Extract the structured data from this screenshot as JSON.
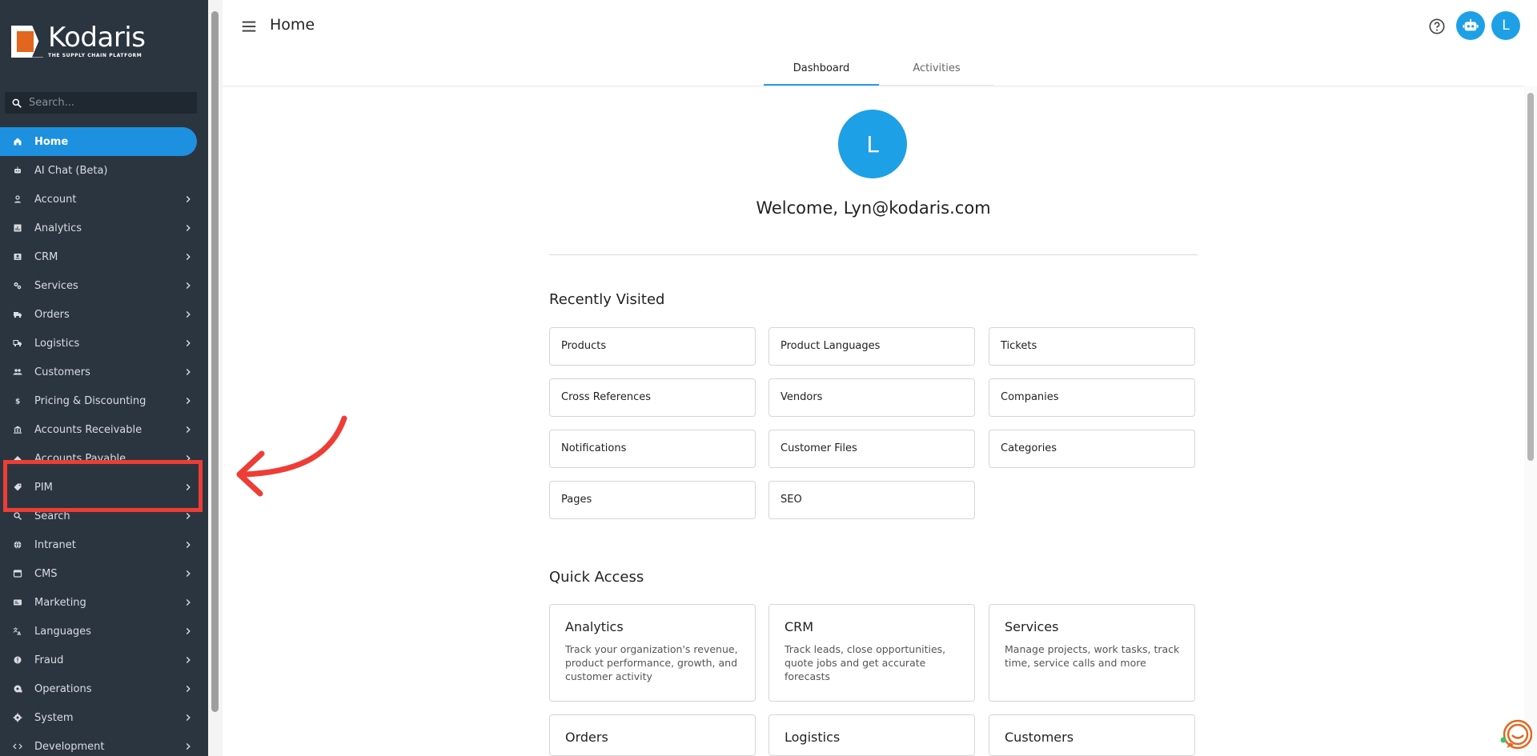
{
  "brand": {
    "name": "Kodaris",
    "tagline": "THE SUPPLY CHAIN PLATFORM"
  },
  "search": {
    "placeholder": "Search..."
  },
  "sidebar": {
    "items": [
      {
        "label": "Home",
        "icon": "home-icon",
        "active": true,
        "chevron": false
      },
      {
        "label": "AI Chat (Beta)",
        "icon": "robot-icon",
        "active": false,
        "chevron": false
      },
      {
        "label": "Account",
        "icon": "person-icon",
        "active": false,
        "chevron": true
      },
      {
        "label": "Analytics",
        "icon": "chart-icon",
        "active": false,
        "chevron": true
      },
      {
        "label": "CRM",
        "icon": "contact-card-icon",
        "active": false,
        "chevron": true
      },
      {
        "label": "Services",
        "icon": "gears-icon",
        "active": false,
        "chevron": true
      },
      {
        "label": "Orders",
        "icon": "truck-icon",
        "active": false,
        "chevron": true
      },
      {
        "label": "Logistics",
        "icon": "delivery-icon",
        "active": false,
        "chevron": true
      },
      {
        "label": "Customers",
        "icon": "people-icon",
        "active": false,
        "chevron": true
      },
      {
        "label": "Pricing & Discounting",
        "icon": "dollar-icon",
        "active": false,
        "chevron": true
      },
      {
        "label": "Accounts Receivable",
        "icon": "bank-icon",
        "active": false,
        "chevron": true
      },
      {
        "label": "Accounts Payable",
        "icon": "payable-icon",
        "active": false,
        "chevron": true
      },
      {
        "label": "PIM",
        "icon": "tag-icon",
        "active": false,
        "chevron": true
      },
      {
        "label": "Search",
        "icon": "search-icon",
        "active": false,
        "chevron": true
      },
      {
        "label": "Intranet",
        "icon": "globe-icon",
        "active": false,
        "chevron": true
      },
      {
        "label": "CMS",
        "icon": "cms-icon",
        "active": false,
        "chevron": true
      },
      {
        "label": "Marketing",
        "icon": "marketing-icon",
        "active": false,
        "chevron": true
      },
      {
        "label": "Languages",
        "icon": "translate-icon",
        "active": false,
        "chevron": true
      },
      {
        "label": "Fraud",
        "icon": "alert-icon",
        "active": false,
        "chevron": true
      },
      {
        "label": "Operations",
        "icon": "operations-icon",
        "active": false,
        "chevron": true
      },
      {
        "label": "System",
        "icon": "gear-icon",
        "active": false,
        "chevron": true
      },
      {
        "label": "Development",
        "icon": "code-icon",
        "active": false,
        "chevron": true
      }
    ]
  },
  "header": {
    "title": "Home",
    "avatar_letter": "L"
  },
  "tabs": [
    {
      "label": "Dashboard",
      "active": true
    },
    {
      "label": "Activities",
      "active": false
    }
  ],
  "welcome": {
    "avatar_letter": "L",
    "text": "Welcome, Lyn@kodaris.com"
  },
  "recently_visited": {
    "title": "Recently Visited",
    "items": [
      "Products",
      "Product Languages",
      "Tickets",
      "Cross References",
      "Vendors",
      "Companies",
      "Notifications",
      "Customer Files",
      "Categories",
      "Pages",
      "SEO"
    ]
  },
  "quick_access": {
    "title": "Quick Access",
    "items": [
      {
        "title": "Analytics",
        "desc": "Track your organization's revenue, product performance, growth, and customer activity"
      },
      {
        "title": "CRM",
        "desc": "Track leads, close opportunities, quote jobs and get accurate forecasts"
      },
      {
        "title": "Services",
        "desc": "Manage projects, work tasks, track time, service calls and more"
      },
      {
        "title": "Orders",
        "desc": ""
      },
      {
        "title": "Logistics",
        "desc": ""
      },
      {
        "title": "Customers",
        "desc": ""
      }
    ]
  },
  "colors": {
    "sidebar_bg": "#2b3540",
    "accent": "#1ea0e6",
    "highlight": "#ee3d35",
    "brand_orange": "#e3661f"
  }
}
